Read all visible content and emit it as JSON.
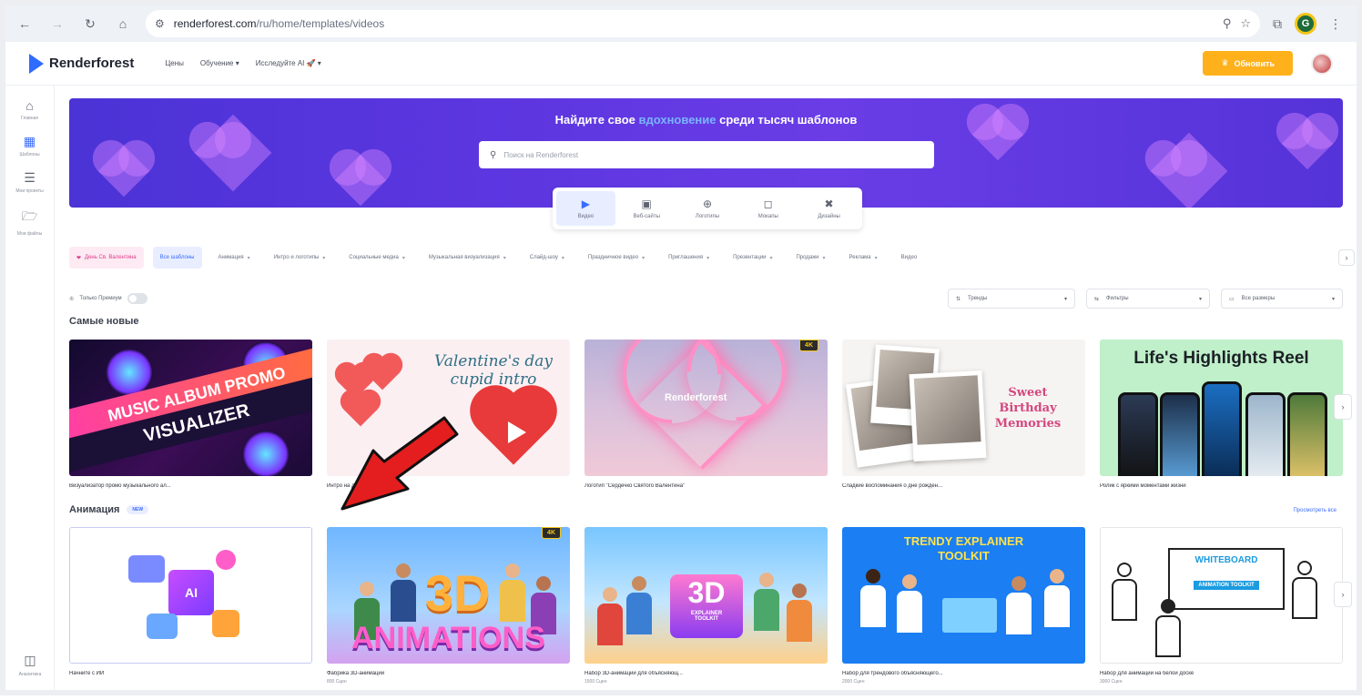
{
  "browser": {
    "url_host": "renderforest.com",
    "url_path": "/ru/home/templates/videos",
    "profile_initial": "G"
  },
  "header": {
    "logo_text": "Renderforest",
    "nav": [
      "Цены",
      "Обучение",
      "Исследуйте AI 🚀"
    ],
    "upgrade_label": "Обновить"
  },
  "sidebar": {
    "items": [
      {
        "label": "Главная",
        "icon": "home-icon"
      },
      {
        "label": "Шаблоны",
        "icon": "templates-icon"
      },
      {
        "label": "Мои проекты",
        "icon": "layers-icon"
      },
      {
        "label": "Мои файлы",
        "icon": "folder-icon"
      }
    ],
    "bottom_label": "Аналитика"
  },
  "hero": {
    "title_before": "Найдите свое ",
    "title_accent": "вдохновение",
    "title_after": " среди тысяч шаблонов",
    "search_placeholder": "Поиск на Renderforest",
    "categories": [
      "Видео",
      "Веб-сайты",
      "Логотипы",
      "Мокапы",
      "Дизайны"
    ],
    "active_category": "Видео",
    "bg_color": "#5b36df",
    "accent_color": "#7ab4ff"
  },
  "chips": [
    "День Св. Валентина",
    "Все шаблоны",
    "Анимация",
    "Интро и логотипы",
    "Социальные медиа",
    "Музыкальная визуализация",
    "Слайд-шоу",
    "Праздничное видео",
    "Приглашения",
    "Презентации",
    "Продажи",
    "Реклама",
    "Видео"
  ],
  "controls": {
    "premium_label": "Только Премиум",
    "sort_label": "Тренды",
    "filter_label": "Фильтры",
    "size_label": "Все размеры"
  },
  "sections": {
    "newest": {
      "title": "Самые новые",
      "cards": [
        {
          "title": "Визуализатор промо музыкального ал...",
          "thumb_text": [
            "MUSIC ALBUM PROMO",
            "VISUALIZER"
          ]
        },
        {
          "title": "Интро на день святого Вале...",
          "thumb_text": [
            "Valentine's day",
            "cupid intro"
          ]
        },
        {
          "title": "Логотип \"Сердечко Святого Валентина\"",
          "thumb_text": [
            "Renderforest"
          ],
          "badge": "4K"
        },
        {
          "title": "Сладкие воспоминания о дне рожден...",
          "thumb_text": [
            "Sweet",
            "Birthday",
            "Memories"
          ]
        },
        {
          "title": "Ролик с яркими моментами жизни",
          "thumb_text": [
            "Life's Highlights Reel"
          ]
        }
      ]
    },
    "animation": {
      "title": "Анимация",
      "badge": "NEW",
      "see_all": "Просмотреть все",
      "cards": [
        {
          "title": "Начните с ИИ",
          "sub": "",
          "thumb_text": [
            "AI"
          ]
        },
        {
          "title": "Фабрика 3D-анимации",
          "sub": "800 Сцен",
          "thumb_text": [
            "3D",
            "ANIMATIONS"
          ],
          "badge": "4K"
        },
        {
          "title": "Набор 3D-анимаций для объясняющ...",
          "sub": "1500 Сцен",
          "thumb_text": [
            "3D",
            "EXPLAINER",
            "TOOLKIT"
          ]
        },
        {
          "title": "Набор для трендового объясняющего...",
          "sub": "2000 Сцен",
          "thumb_text": [
            "TRENDY EXPLAINER",
            "TOOLKIT"
          ]
        },
        {
          "title": "Набор для анимации на белой доске",
          "sub": "3000 Сцен",
          "thumb_text": [
            "WHITEBOARD",
            "ANIMATION TOOLKIT"
          ]
        }
      ]
    }
  },
  "colors": {
    "brand_blue": "#3b6cff",
    "upgrade": "#ffb11b",
    "arrow_red": "#e41e1e"
  }
}
